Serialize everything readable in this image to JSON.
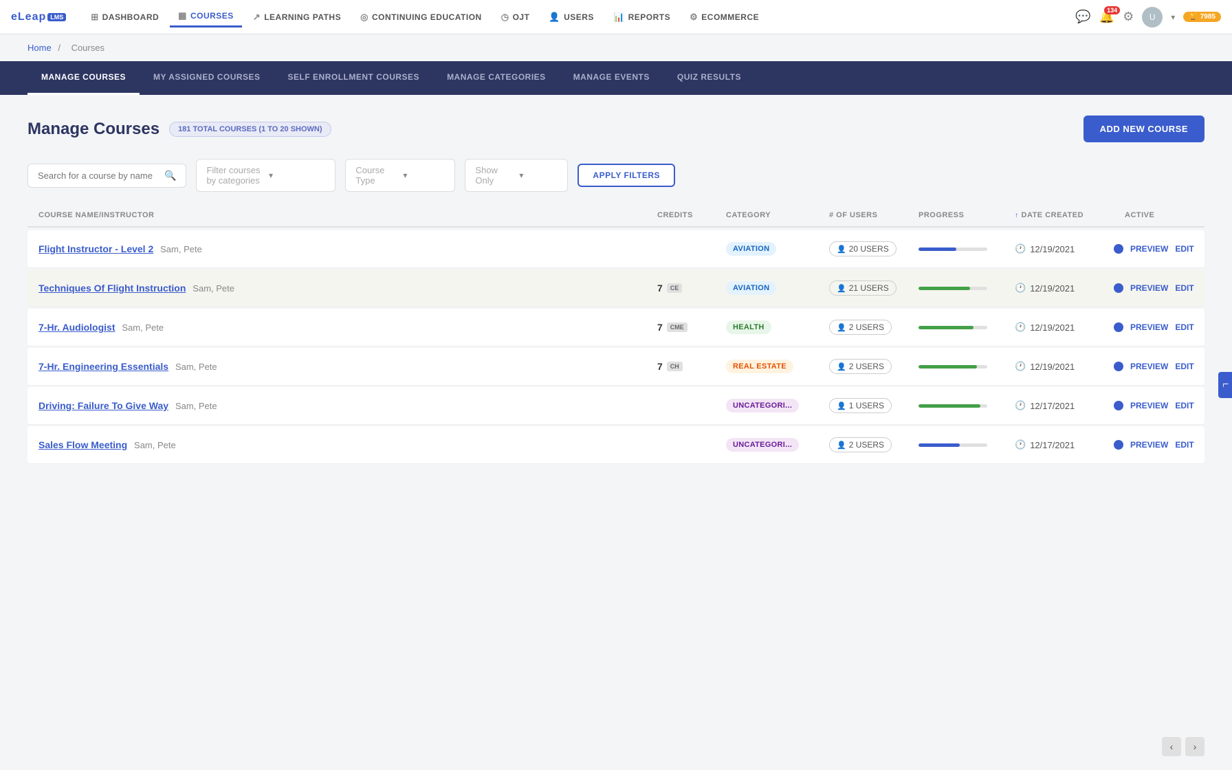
{
  "brand": {
    "name": "eLeap",
    "lms": "LMS"
  },
  "nav": {
    "items": [
      {
        "label": "Dashboard",
        "icon": "⊞",
        "active": false
      },
      {
        "label": "Courses",
        "icon": "▦",
        "active": true
      },
      {
        "label": "Learning Paths",
        "icon": "↗",
        "active": false
      },
      {
        "label": "Continuing Education",
        "icon": "◎",
        "active": false
      },
      {
        "label": "OJT",
        "icon": "◷",
        "active": false
      },
      {
        "label": "Users",
        "icon": "👤",
        "active": false
      },
      {
        "label": "Reports",
        "icon": "📊",
        "active": false
      },
      {
        "label": "Ecommerce",
        "icon": "⚙",
        "active": false
      }
    ],
    "notification_count": "134",
    "points": "7985"
  },
  "breadcrumb": {
    "home": "Home",
    "separator": "/",
    "current": "Courses"
  },
  "sub_tabs": [
    {
      "label": "Manage Courses",
      "active": true
    },
    {
      "label": "My Assigned Courses",
      "active": false
    },
    {
      "label": "Self Enrollment Courses",
      "active": false
    },
    {
      "label": "Manage Categories",
      "active": false
    },
    {
      "label": "Manage Events",
      "active": false
    },
    {
      "label": "Quiz Results",
      "active": false
    }
  ],
  "page": {
    "title": "Manage Courses",
    "count_badge": "181 TOTAL COURSES (1 TO 20 SHOWN)",
    "add_button": "ADD NEW COURSE"
  },
  "filters": {
    "search_placeholder": "Search for a course by name",
    "category_placeholder": "Filter courses by categories",
    "course_type_placeholder": "Course Type",
    "show_only_placeholder": "Show Only",
    "apply_button": "APPLY FILTERS"
  },
  "table": {
    "columns": [
      {
        "label": "COURSE NAME/INSTRUCTOR",
        "sortable": false
      },
      {
        "label": "CREDITS",
        "sortable": false
      },
      {
        "label": "CATEGORY",
        "sortable": false
      },
      {
        "label": "# OF USERS",
        "sortable": false
      },
      {
        "label": "PROGRESS",
        "sortable": false
      },
      {
        "label": "DATE CREATED",
        "sortable": true
      },
      {
        "label": "ACTIVE",
        "sortable": false
      }
    ],
    "rows": [
      {
        "name": "Flight Instructor - Level 2",
        "instructor": "Sam, Pete",
        "credits": "",
        "credits_badge": "",
        "category": "AVIATION",
        "category_class": "cat-aviation",
        "users": "20 USERS",
        "progress": 55,
        "progress_color": "progress-blue",
        "date": "12/19/2021",
        "active": true,
        "highlighted": false,
        "preview": "PREVIEW",
        "edit": "EDIT"
      },
      {
        "name": "Techniques Of Flight Instruction",
        "instructor": "Sam, Pete",
        "credits": "7",
        "credits_badge": "CE",
        "category": "AVIATION",
        "category_class": "cat-aviation",
        "users": "21 USERS",
        "progress": 75,
        "progress_color": "progress-green",
        "date": "12/19/2021",
        "active": true,
        "highlighted": true,
        "preview": "PREVIEW",
        "edit": "EDIT"
      },
      {
        "name": "7-Hr. Audiologist",
        "instructor": "Sam, Pete",
        "credits": "7",
        "credits_badge": "CME",
        "category": "HEALTH",
        "category_class": "cat-health",
        "users": "2 USERS",
        "progress": 80,
        "progress_color": "progress-green",
        "date": "12/19/2021",
        "active": true,
        "highlighted": false,
        "preview": "PREVIEW",
        "edit": "EDIT"
      },
      {
        "name": "7-Hr. Engineering Essentials",
        "instructor": "Sam, Pete",
        "credits": "7",
        "credits_badge": "CH",
        "category": "REAL ESTATE",
        "category_class": "cat-realestate",
        "users": "2 USERS",
        "progress": 85,
        "progress_color": "progress-green",
        "date": "12/19/2021",
        "active": true,
        "highlighted": false,
        "preview": "PREVIEW",
        "edit": "EDIT"
      },
      {
        "name": "Driving: Failure To Give Way",
        "instructor": "Sam, Pete",
        "credits": "",
        "credits_badge": "",
        "category": "UNCATEGORI...",
        "category_class": "cat-uncategori",
        "users": "1 USERS",
        "progress": 90,
        "progress_color": "progress-green",
        "date": "12/17/2021",
        "active": true,
        "highlighted": false,
        "preview": "PREVIEW",
        "edit": "EDIT"
      },
      {
        "name": "Sales Flow Meeting",
        "instructor": "Sam, Pete",
        "credits": "",
        "credits_badge": "",
        "category": "UNCATEGORI...",
        "category_class": "cat-uncategori",
        "users": "2 USERS",
        "progress": 60,
        "progress_color": "progress-blue",
        "date": "12/17/2021",
        "active": true,
        "highlighted": false,
        "preview": "PREVIEW",
        "edit": "EDIT"
      }
    ]
  }
}
